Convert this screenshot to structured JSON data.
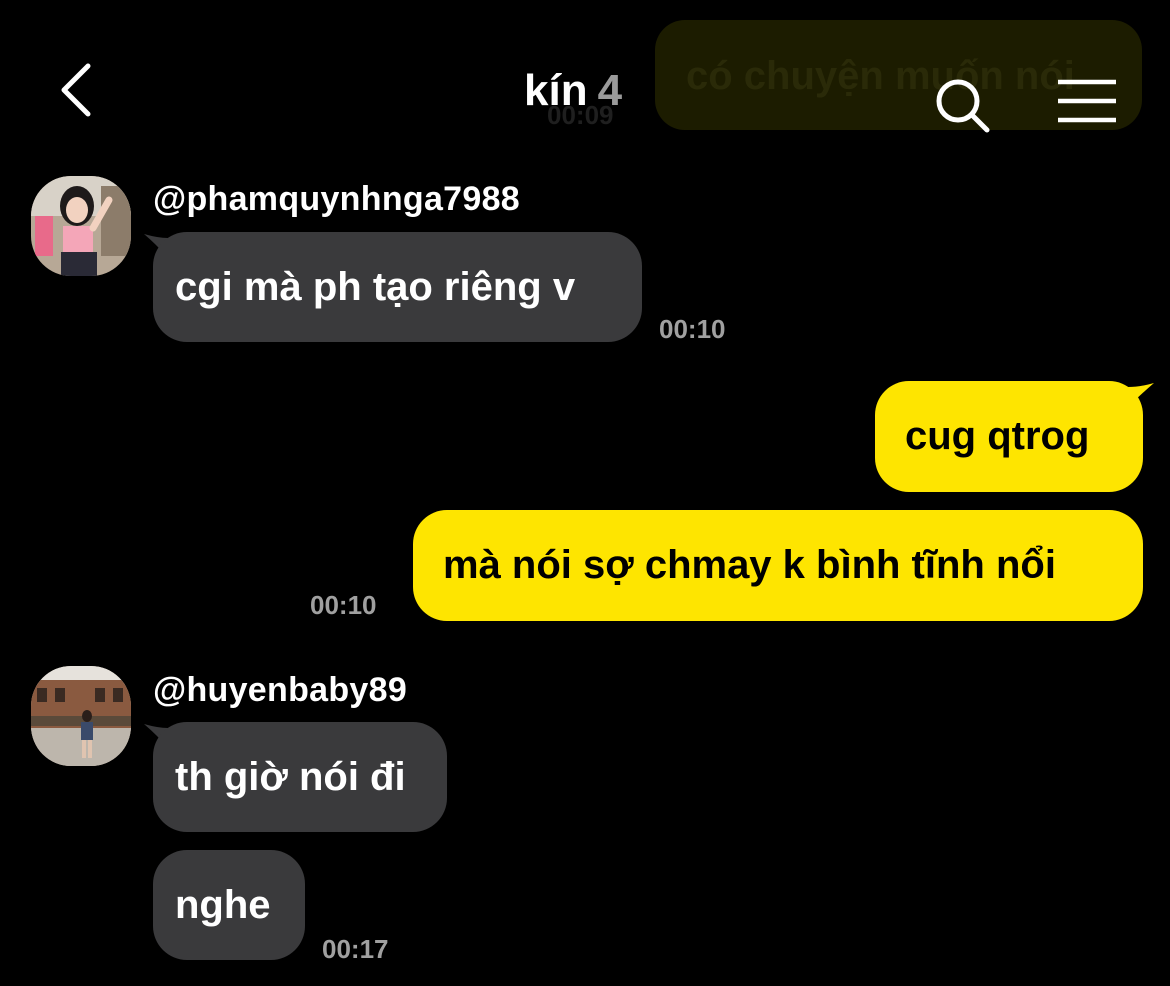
{
  "header": {
    "title": "kín",
    "member_count": "4",
    "back_icon": "chevron-left-icon",
    "search_icon": "search-icon",
    "menu_icon": "hamburger-menu-icon"
  },
  "colors": {
    "background": "#000000",
    "incoming_bubble": "#3a3a3c",
    "outgoing_bubble": "#fee500",
    "timestamp": "#a0a0a0"
  },
  "faded_message": {
    "text": "có chuyện muốn nói",
    "time": "00:09"
  },
  "messages": [
    {
      "sender": "@phamquynhnga7988",
      "avatar": "avatar-woman-pink-top",
      "bubbles": [
        "cgi mà ph tạo riêng v"
      ],
      "time": "00:10"
    },
    {
      "sender": "me",
      "bubbles": [
        "cug qtrog",
        "mà nói sợ chmay k bình tĩnh nổi"
      ],
      "time": "00:10"
    },
    {
      "sender": "@huyenbaby89",
      "avatar": "avatar-woman-city-street",
      "bubbles": [
        "th giờ nói đi",
        "nghe"
      ],
      "time": "00:17"
    }
  ]
}
